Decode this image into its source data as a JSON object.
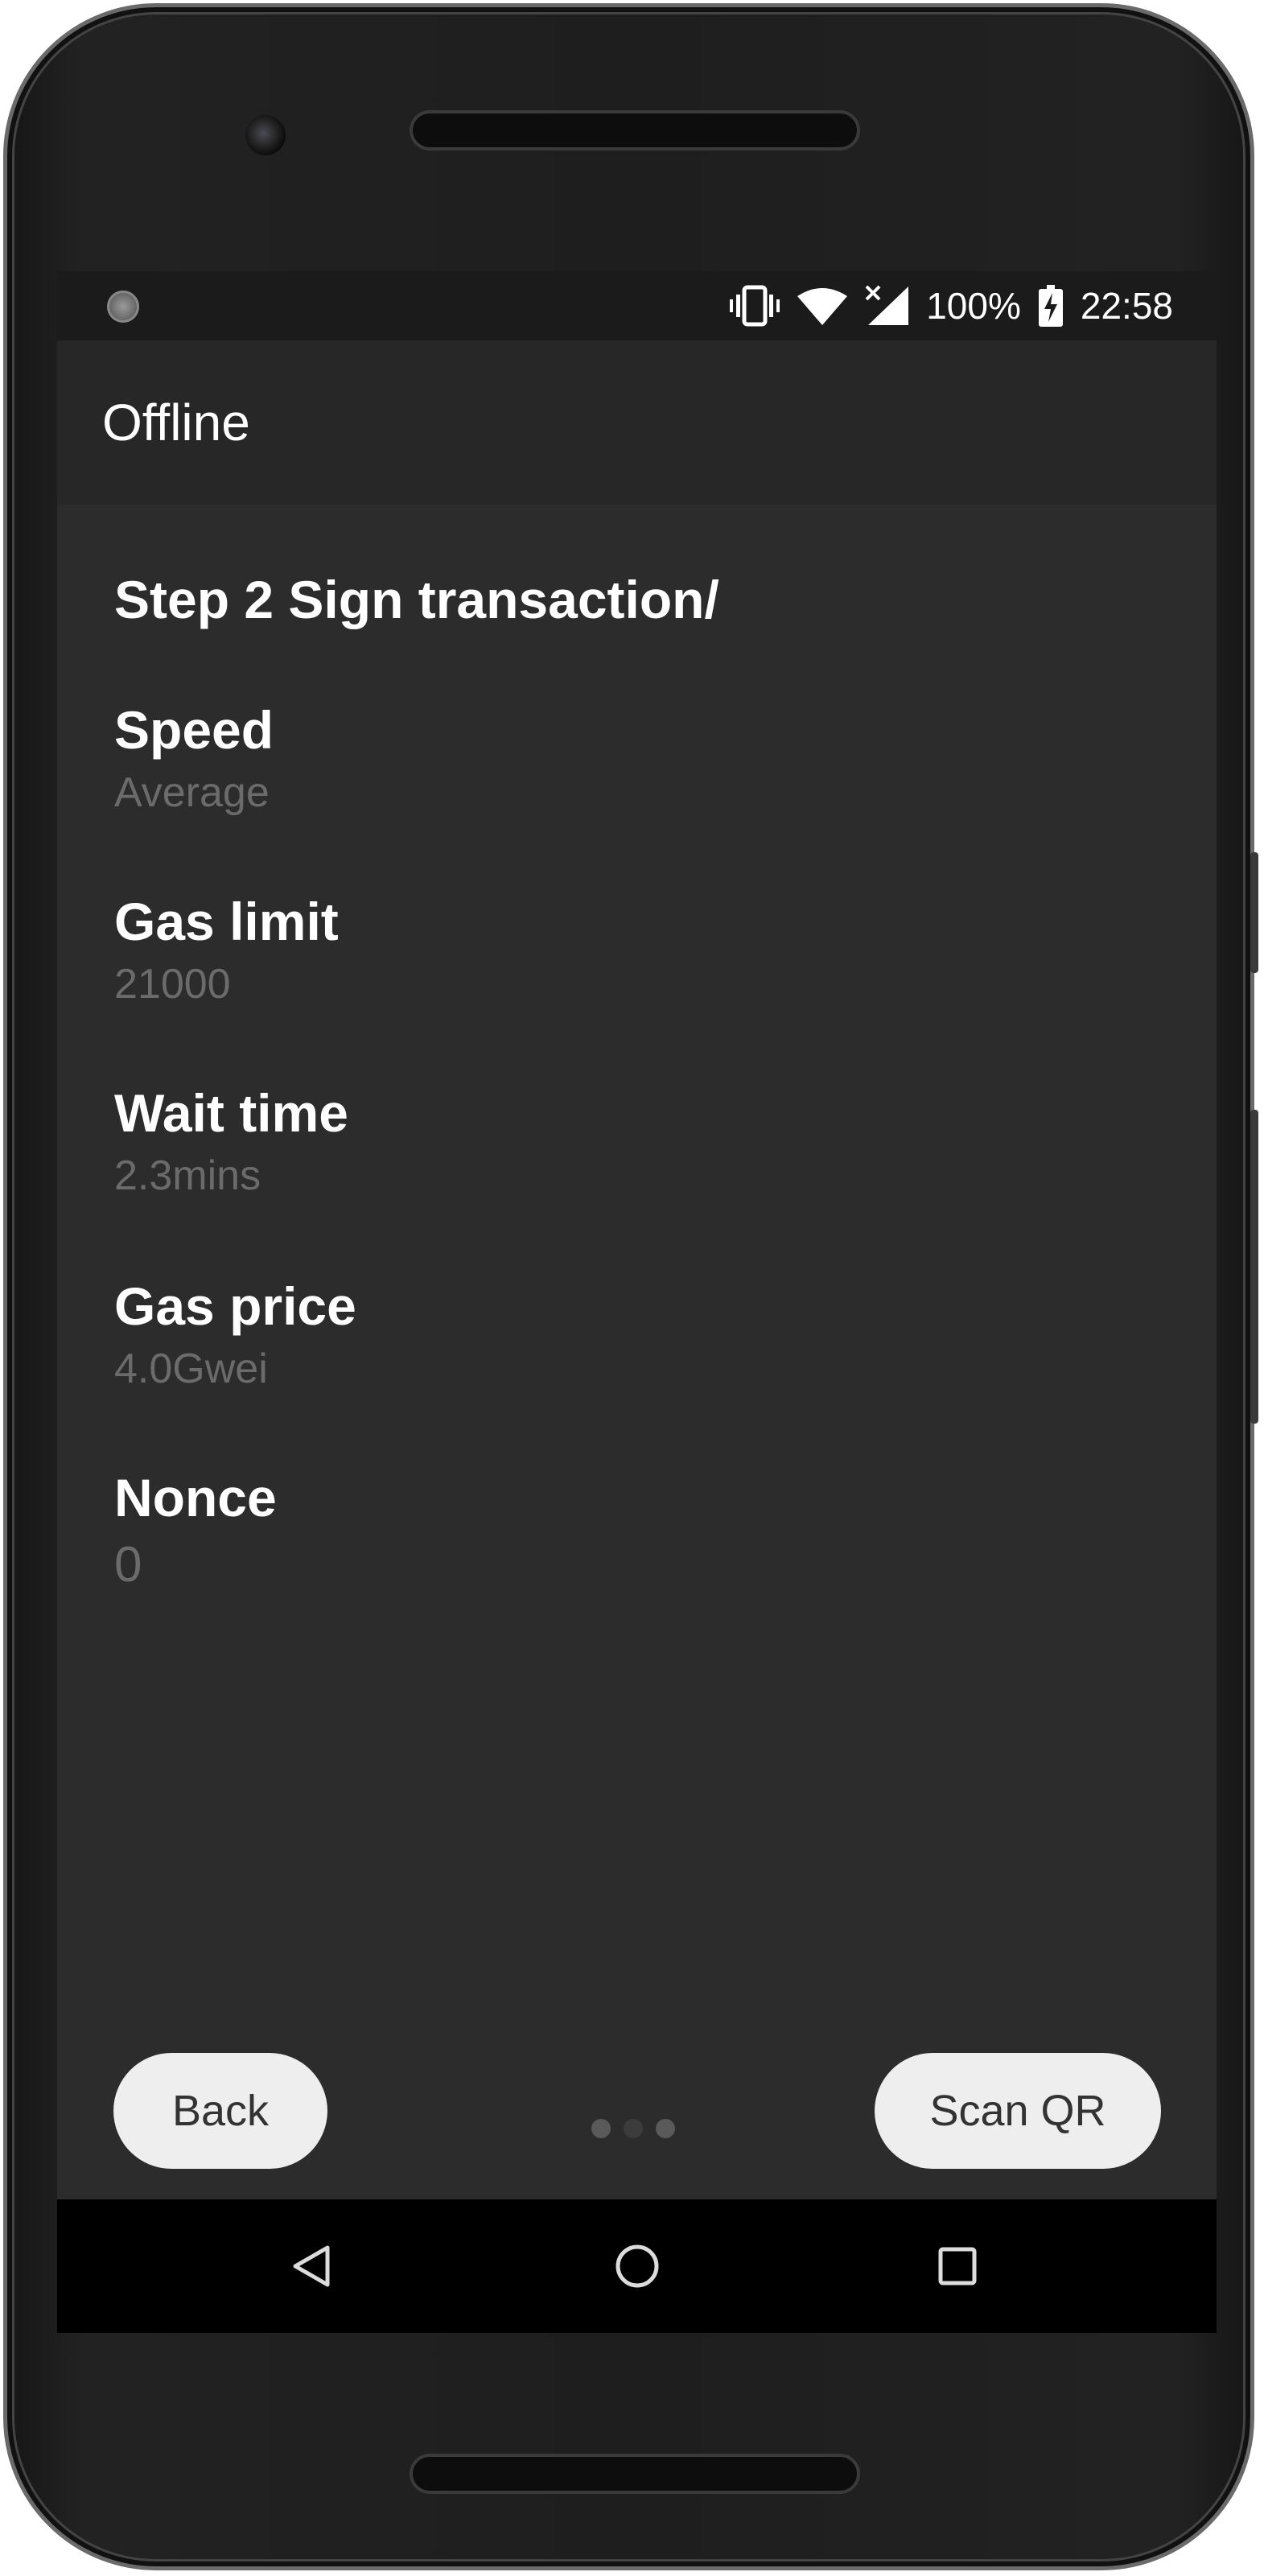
{
  "status_bar": {
    "battery_percent": "100%",
    "time": "22:58",
    "icons": [
      "notification-icon",
      "vibrate-icon",
      "wifi-icon",
      "cell-no-signal-icon",
      "battery-charging-icon"
    ]
  },
  "app_bar": {
    "title": "Offline"
  },
  "main": {
    "step_title": "Step 2 Sign transaction/",
    "fields": [
      {
        "label": "Speed",
        "value": "Average"
      },
      {
        "label": "Gas limit",
        "value": "21000"
      },
      {
        "label": "Wait time",
        "value": "2.3mins"
      },
      {
        "label": "Gas price",
        "value": "4.0Gwei"
      },
      {
        "label": "Nonce",
        "value": "0"
      }
    ]
  },
  "footer": {
    "back_label": "Back",
    "scan_label": "Scan QR",
    "pager": {
      "total": 3,
      "current": 2
    }
  },
  "nav_bar": {
    "icons": [
      "back-triangle-icon",
      "home-circle-icon",
      "recents-square-icon"
    ]
  },
  "colors": {
    "screen_bg": "#2c2c2c",
    "app_bar_bg": "#272727",
    "status_bar_bg": "#1b1b1b",
    "label_text": "#ffffff",
    "value_text": "#6b6b6b",
    "button_bg": "#eeeeee",
    "button_text": "#333333"
  }
}
